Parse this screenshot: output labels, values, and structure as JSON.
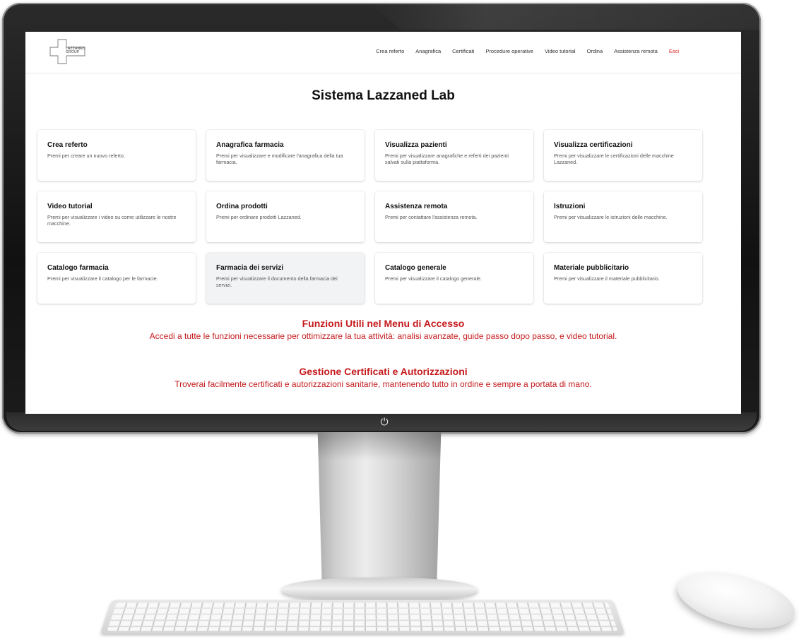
{
  "logo": {
    "text": "LAZZANED GROUP"
  },
  "nav": {
    "links": [
      "Crea referto",
      "Anagrafica",
      "Certificati",
      "Procedure operative",
      "Video tutorial",
      "Ordina",
      "Assistenza remota"
    ],
    "logout": "Esci"
  },
  "page_title": "Sistema Lazzaned Lab",
  "cards": [
    {
      "title": "Crea referto",
      "desc": "Premi per creare un nuovo referto."
    },
    {
      "title": "Anagrafica farmacia",
      "desc": "Premi per visualizzare e modificare l'anagrafica della tua farmacia."
    },
    {
      "title": "Visualizza pazienti",
      "desc": "Premi per visualizzare anagrafiche e referti dei pazienti salvati sulla piattaforma."
    },
    {
      "title": "Visualizza certificazioni",
      "desc": "Premi per visualizzare le certificazioni delle macchine Lazzaned."
    },
    {
      "title": "Video tutorial",
      "desc": "Premi per visualizzare i video su come utilizzare le nostre macchine."
    },
    {
      "title": "Ordina prodotti",
      "desc": "Premi per ordinare prodotti Lazzaned."
    },
    {
      "title": "Assistenza remota",
      "desc": "Premi per contattare l'assistenza remota."
    },
    {
      "title": "Istruzioni",
      "desc": "Premi per visualizzare le istruzioni delle macchine."
    },
    {
      "title": "Catalogo farmacia",
      "desc": "Premi per visualizzare il catalogo per le farmacie."
    },
    {
      "title": "Farmacia dei servizi",
      "desc": "Premi per visualizzare il documento della farmacia dei servizi."
    },
    {
      "title": "Catalogo generale",
      "desc": "Premi per visualizzare il catalogo generale."
    },
    {
      "title": "Materiale pubblicitario",
      "desc": "Premi per visualizzare il materiale pubblicitario."
    }
  ],
  "info": [
    {
      "title": "Funzioni Utili nel Menu di Accesso",
      "text": "Accedi a tutte le funzioni necessarie per ottimizzare la tua attività: analisi avanzate, guide passo dopo passo, e video tutorial."
    },
    {
      "title": "Gestione Certificati e Autorizzazioni",
      "text": "Troverai facilmente certificati e autorizzazioni sanitarie, mantenendo tutto in ordine e sempre a portata di mano."
    }
  ],
  "colors": {
    "accent_red": "#c5191c",
    "logout_red": "#e02424",
    "hover_card": "#f2f3f5"
  },
  "icons": {
    "power": "power-icon",
    "logo": "cross-logo-icon"
  }
}
